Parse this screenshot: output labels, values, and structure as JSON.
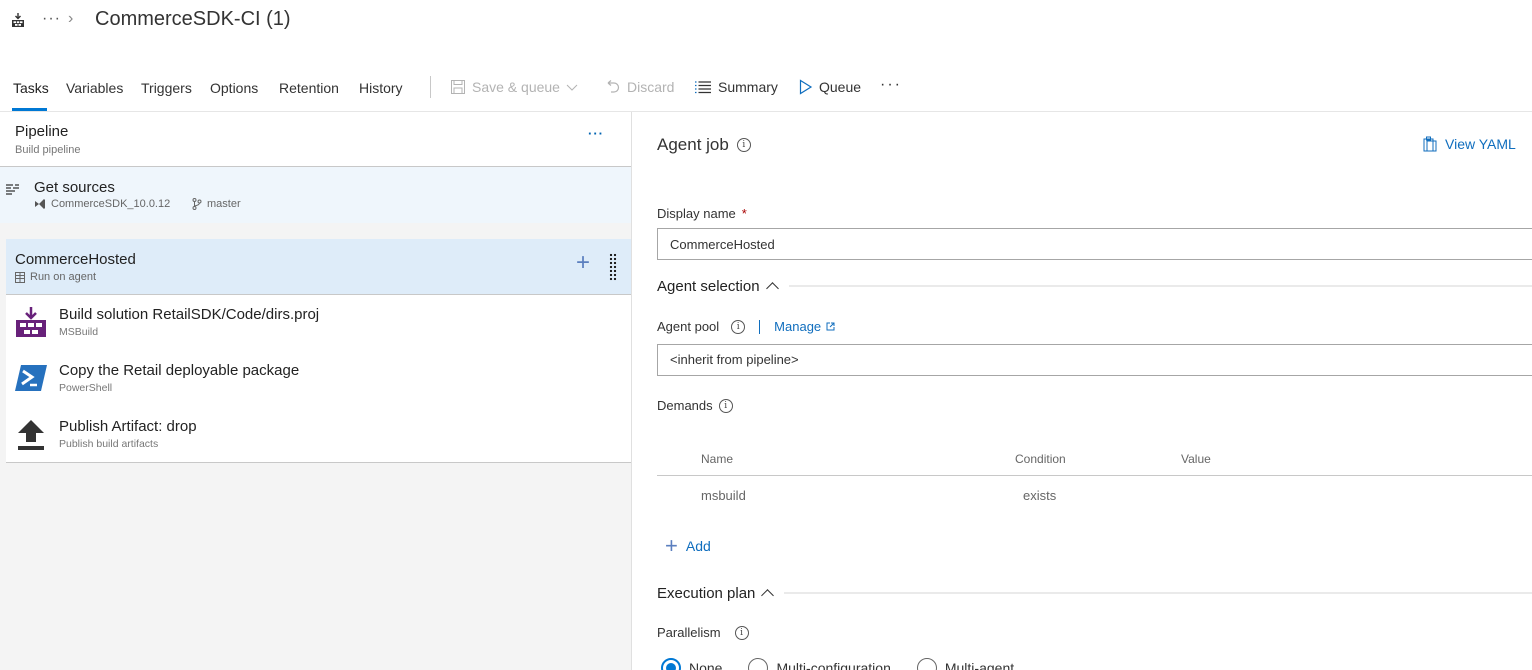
{
  "header": {
    "breadcrumb_more": "···",
    "title": "CommerceSDK-CI (1)"
  },
  "tabs": [
    {
      "label": "Tasks",
      "active": true
    },
    {
      "label": "Variables"
    },
    {
      "label": "Triggers"
    },
    {
      "label": "Options"
    },
    {
      "label": "Retention"
    },
    {
      "label": "History"
    }
  ],
  "toolbar": {
    "save_queue": "Save & queue",
    "discard": "Discard",
    "summary": "Summary",
    "queue": "Queue",
    "more": "···"
  },
  "pipeline": {
    "title": "Pipeline",
    "subtitle": "Build pipeline",
    "more": "···"
  },
  "get_sources": {
    "title": "Get sources",
    "repo": "CommerceSDK_10.0.12",
    "branch": "master"
  },
  "job": {
    "title": "CommerceHosted",
    "subtitle": "Run on agent"
  },
  "tasks": [
    {
      "title": "Build solution RetailSDK/Code/dirs.proj",
      "subtitle": "MSBuild"
    },
    {
      "title": "Copy the Retail deployable package",
      "subtitle": "PowerShell"
    },
    {
      "title": "Publish Artifact: drop",
      "subtitle": "Publish build artifacts"
    }
  ],
  "details": {
    "title": "Agent job",
    "view_yaml": "View YAML",
    "display_name_label": "Display name",
    "required_mark": "*",
    "display_name_value": "CommerceHosted",
    "agent_selection": "Agent selection",
    "agent_pool_label": "Agent pool",
    "manage": "Manage",
    "agent_pool_value": "<inherit from pipeline>",
    "demands_label": "Demands",
    "demands_columns": [
      "Name",
      "Condition",
      "Value"
    ],
    "demands_rows": [
      {
        "name": "msbuild",
        "condition": "exists",
        "value": ""
      }
    ],
    "add": "Add",
    "execution_plan": "Execution plan",
    "parallelism_label": "Parallelism",
    "parallelism_options": [
      {
        "label": "None",
        "selected": true
      },
      {
        "label": "Multi-configuration",
        "selected": false
      },
      {
        "label": "Multi-agent",
        "selected": false
      }
    ]
  },
  "colors": {
    "accent": "#0078d4",
    "link": "#106ebe",
    "selected_row": "#deecf9",
    "hover_row": "#eff6fc",
    "msbuild_purple": "#68217a",
    "powershell_blue": "#2671be"
  }
}
